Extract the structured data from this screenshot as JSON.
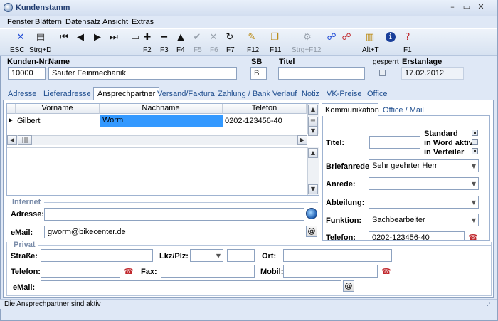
{
  "window": {
    "title": "Kundenstamm"
  },
  "menu": [
    "Fenster",
    "Blättern",
    "Datensatz",
    "Ansicht",
    "Extras"
  ],
  "toolbar": {
    "icons": [
      {
        "name": "esc-close-icon",
        "glyph": "✕",
        "color": "#1f4bd6"
      },
      {
        "name": "print-icon",
        "glyph": "▤",
        "color": "#333333"
      },
      {
        "name": "first-record-icon",
        "glyph": "⏮",
        "color": "#111111"
      },
      {
        "name": "prev-record-icon",
        "glyph": "◀",
        "color": "#111111"
      },
      {
        "name": "next-record-icon",
        "glyph": "▶",
        "color": "#111111"
      },
      {
        "name": "last-record-icon",
        "glyph": "⏭",
        "color": "#111111"
      },
      {
        "name": "split-view-icon",
        "glyph": "▭",
        "color": "#333333"
      },
      {
        "name": "add-record-icon",
        "glyph": "✚",
        "color": "#111111"
      },
      {
        "name": "delete-record-icon",
        "glyph": "━",
        "color": "#111111"
      },
      {
        "name": "edit-record-icon",
        "glyph": "▲",
        "color": "#111111"
      },
      {
        "name": "save-check-icon",
        "glyph": "✔",
        "color": "#9aa3ae"
      },
      {
        "name": "cancel-x-icon",
        "glyph": "✕",
        "color": "#9aa3ae"
      },
      {
        "name": "refresh-icon",
        "glyph": "↻",
        "color": "#111111"
      },
      {
        "name": "clear-filter-icon",
        "glyph": "✎",
        "color": "#b8860b"
      },
      {
        "name": "copy-icon",
        "glyph": "❐",
        "color": "#b8860b"
      },
      {
        "name": "hierarchy-icon",
        "glyph": "⚙",
        "color": "#9aa3ae"
      },
      {
        "name": "search-people-icon",
        "glyph": "☍",
        "color": "#1f4bd6"
      },
      {
        "name": "replace-people-icon",
        "glyph": "☍",
        "color": "#c0282d"
      },
      {
        "name": "attachments-icon",
        "glyph": "▥",
        "color": "#b8860b"
      },
      {
        "name": "info-icon",
        "glyph": "ℹ",
        "color": "#ffffff"
      },
      {
        "name": "help-icon",
        "glyph": "?",
        "color": "#c0282d"
      }
    ],
    "labels": {
      "esc": "ESC",
      "strg_d": "Strg+D",
      "f2": "F2",
      "f3": "F3",
      "f4": "F4",
      "f5": "F5",
      "f6": "F6",
      "f7": "F7",
      "f12": "F12",
      "f11": "F11",
      "strg_f12": "Strg+F12",
      "alt_t": "Alt+T",
      "f1": "F1"
    }
  },
  "header": {
    "kunden_nr_label": "Kunden-Nr.",
    "kunden_nr": "10000",
    "name_label": "Name",
    "name": "Sauter Feinmechanik",
    "sb_label": "SB",
    "sb": "B",
    "titel_label": "Titel",
    "titel": "",
    "gesperrt_label": "gesperrt",
    "erstanlage_label": "Erstanlage",
    "erstanlage": "17.02.2012"
  },
  "tabs": [
    "Adresse",
    "Lieferadresse",
    "Ansprechpartner",
    "Versand/Faktura",
    "Zahlung / Bank",
    "Verlauf",
    "Notiz",
    "VK-Preise",
    "Office"
  ],
  "active_tab": "Ansprechpartner",
  "grid": {
    "columns": [
      "Vorname",
      "Nachname",
      "Telefon"
    ],
    "rows": [
      {
        "vorname": "Gilbert",
        "nachname": "Worm",
        "telefon": "0202-123456-40"
      }
    ]
  },
  "right_tabs": [
    "Kommunikation",
    "Office / Mail"
  ],
  "kommunikation": {
    "titel_label": "Titel:",
    "titel": "",
    "standard_label": "Standard",
    "word_label": "in Word aktiv",
    "verteiler_label": "in Verteiler",
    "briefanrede_label": "Briefanrede:",
    "briefanrede": "Sehr geehrter Herr",
    "anrede_label": "Anrede:",
    "anrede": "",
    "abteilung_label": "Abteilung:",
    "abteilung": "",
    "funktion_label": "Funktion:",
    "funktion": "Sachbearbeiter",
    "telefon_label": "Telefon:",
    "telefon": "0202-123456-40"
  },
  "internet": {
    "group_label": "Internet",
    "adresse_label": "Adresse:",
    "adresse": "",
    "email_label": "eMail:",
    "email": "gworm@bikecenter.de"
  },
  "privat": {
    "group_label": "Privat",
    "strasse_label": "Straße:",
    "strasse": "",
    "lkz_plz_label": "Lkz/Plz:",
    "lkz": "",
    "plz": "",
    "ort_label": "Ort:",
    "ort": "",
    "telefon_label": "Telefon:",
    "telefon": "",
    "fax_label": "Fax:",
    "fax": "",
    "mobil_label": "Mobil:",
    "mobil": "",
    "email_label": "eMail:",
    "email": ""
  },
  "status": {
    "text": "Die Ansprechpartner sind aktiv"
  }
}
